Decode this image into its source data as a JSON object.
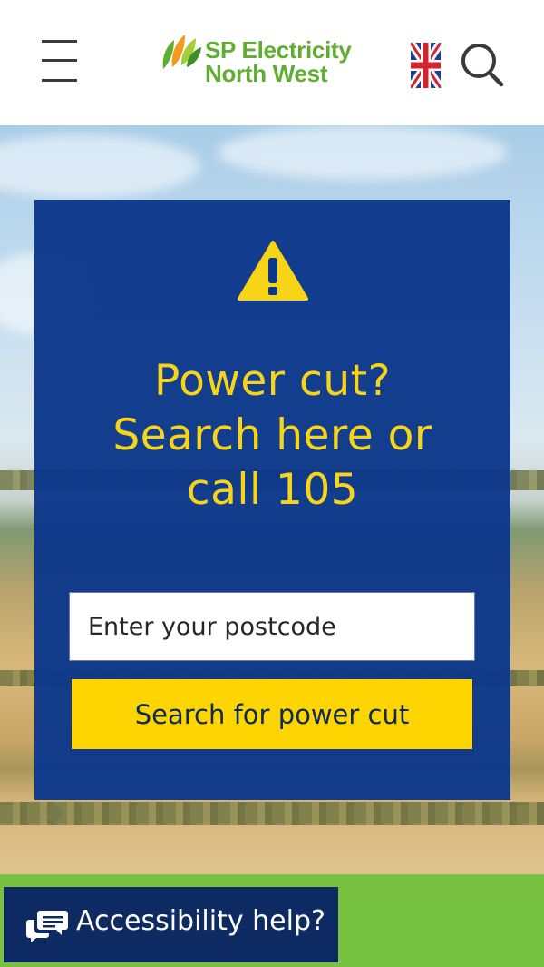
{
  "header": {
    "logo_line1": "SP Electricity",
    "logo_line2": "North West",
    "menu_icon": "hamburger-menu-icon",
    "flag_icon": "uk-flag-icon",
    "search_icon": "search-icon"
  },
  "hero": {
    "warning_icon": "warning-triangle-icon",
    "headline_lines": [
      "Power cut?",
      "Search here or",
      "call 105"
    ],
    "postcode_placeholder": "Enter your postcode",
    "search_button_label": "Search for power cut"
  },
  "accessibility": {
    "label": "Accessibility help?",
    "icon": "chat-bubbles-icon"
  },
  "colors": {
    "brand_green": "#5fae32",
    "panel_blue": "#0c388a",
    "accent_yellow": "#fed500",
    "footer_green": "#78c242",
    "a11y_navy": "#0d2a63"
  }
}
